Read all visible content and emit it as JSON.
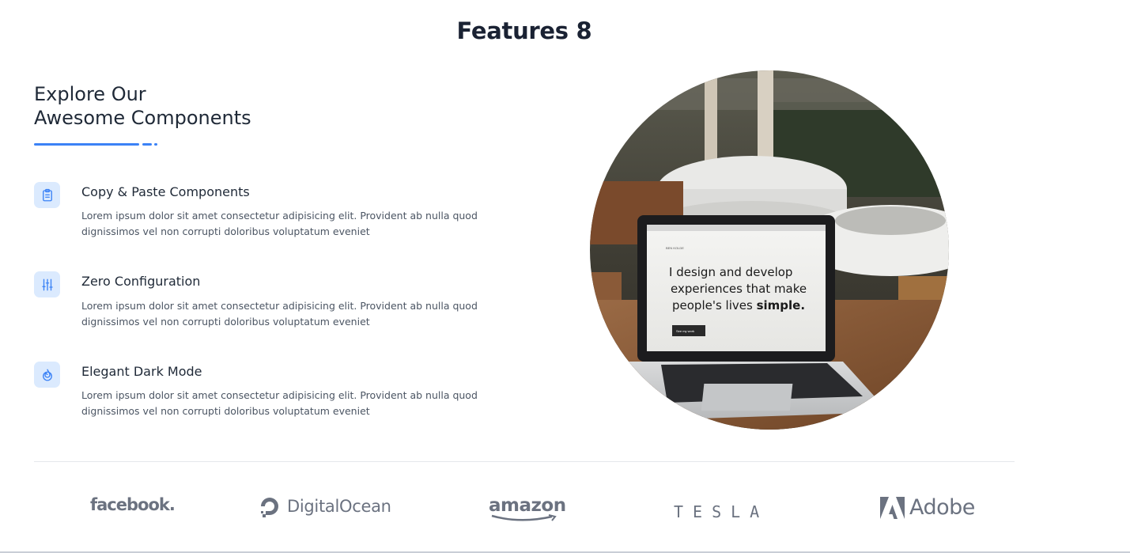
{
  "page": {
    "title": "Features 8"
  },
  "section": {
    "heading_line1": "Explore Our",
    "heading_line2": "Awesome Components",
    "accent_color": "#3b82f6"
  },
  "features": [
    {
      "icon": "clipboard-icon",
      "title": "Copy & Paste Components",
      "description": "Lorem ipsum dolor sit amet consectetur adipisicing elit. Provident ab nulla quod dignissimos vel non corrupti doloribus voluptatum eveniet"
    },
    {
      "icon": "sliders-icon",
      "title": "Zero Configuration",
      "description": "Lorem ipsum dolor sit amet consectetur adipisicing elit. Provident ab nulla quod dignissimos vel non corrupti doloribus voluptatum eveniet"
    },
    {
      "icon": "dark-mode-icon",
      "title": "Elegant Dark Mode",
      "description": "Lorem ipsum dolor sit amet consectetur adipisicing elit. Provident ab nulla quod dignissimos vel non corrupti doloribus voluptatum eveniet"
    }
  ],
  "hero_image": {
    "screen_line1": "I design and develop",
    "screen_line2": "experiences that make",
    "screen_line3_prefix": "people's lives ",
    "screen_line3_bold": "simple.",
    "screen_brand": "BEN KOLDE",
    "screen_button": "See my work"
  },
  "logos": [
    {
      "name": "facebook",
      "label": "facebook."
    },
    {
      "name": "digitalocean",
      "label": "DigitalOcean"
    },
    {
      "name": "amazon",
      "label": "amazon"
    },
    {
      "name": "tesla",
      "label": "TESLA"
    },
    {
      "name": "adobe",
      "label": "Adobe"
    }
  ]
}
